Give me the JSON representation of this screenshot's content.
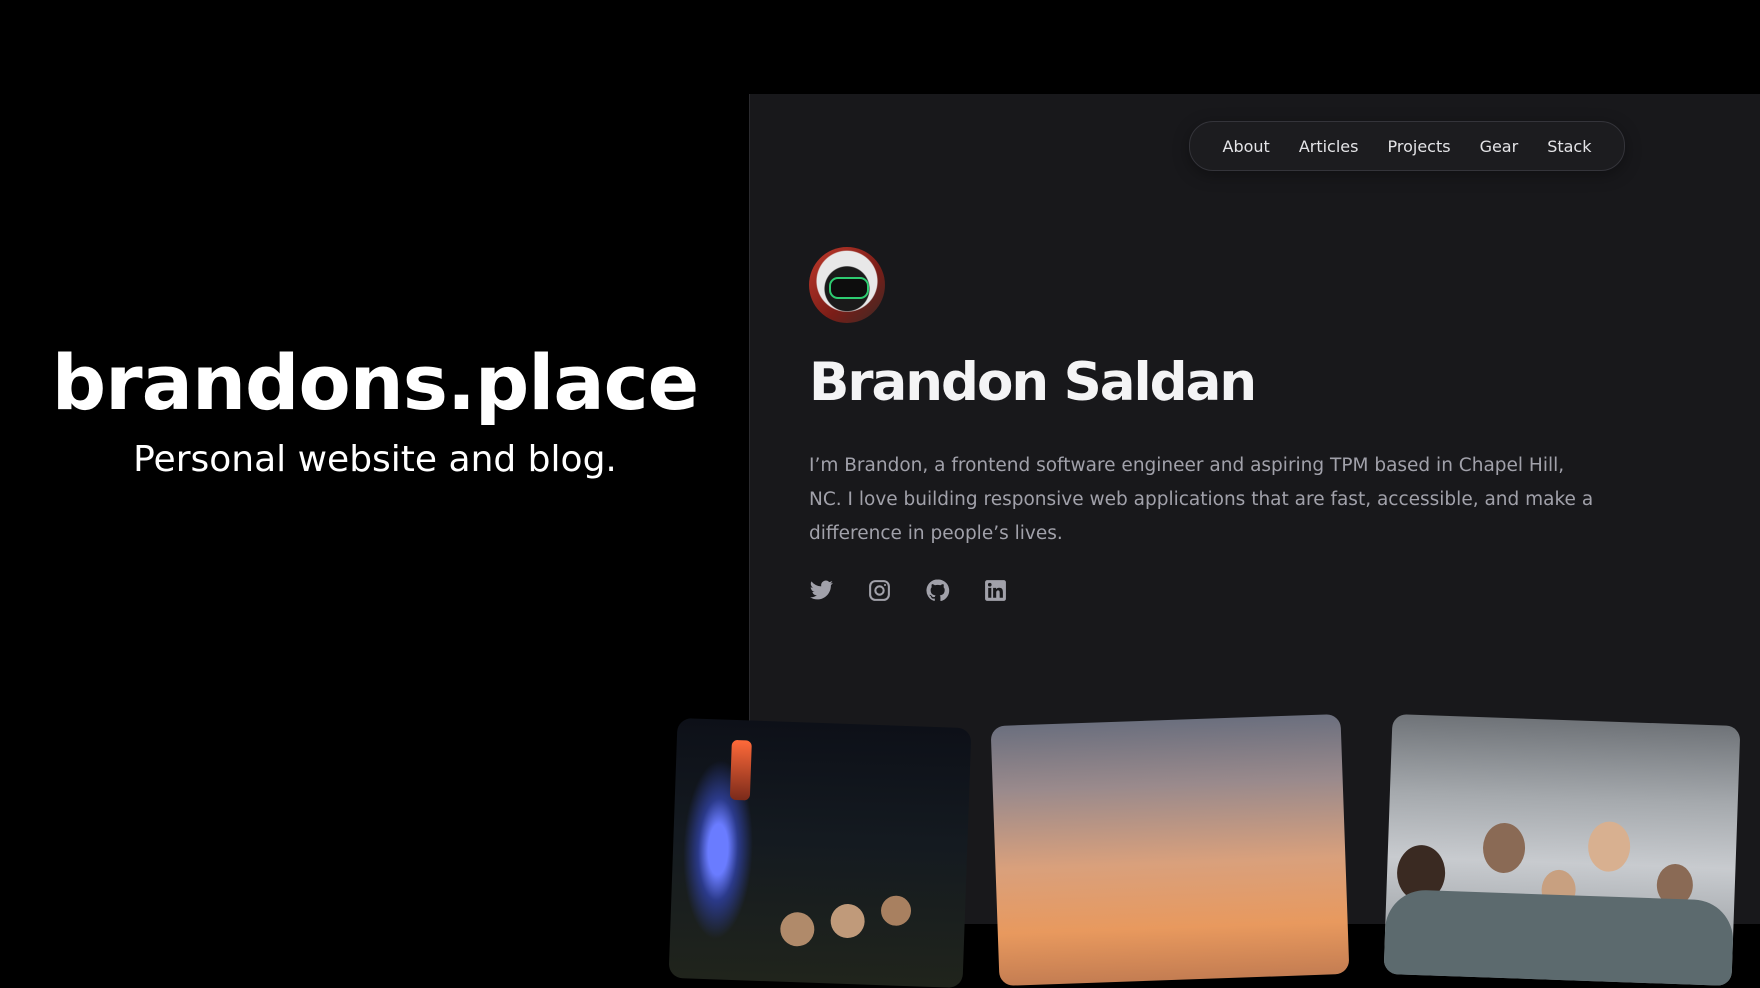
{
  "hero": {
    "title": "brandons.place",
    "tagline": "Personal website and blog."
  },
  "nav": {
    "items": [
      "About",
      "Articles",
      "Projects",
      "Gear",
      "Stack"
    ]
  },
  "profile": {
    "name": "Brandon Saldan",
    "bio": "I’m Brandon, a frontend software engineer and aspiring TPM based in Chapel Hill, NC. I love building responsive web applications that are fast, accessible, and make a difference in people’s lives."
  },
  "socials": [
    {
      "icon": "twitter-icon"
    },
    {
      "icon": "instagram-icon"
    },
    {
      "icon": "github-icon"
    },
    {
      "icon": "linkedin-icon"
    }
  ],
  "photos": [
    {
      "subject": "night-festival"
    },
    {
      "subject": "sunset-clouds"
    },
    {
      "subject": "group-of-friends"
    }
  ],
  "colors": {
    "page_background": "#000000",
    "panel_background": "#18181b",
    "text_primary": "#f4f4f5",
    "text_secondary": "#a1a1aa",
    "icon_color": "#a1a1aa"
  }
}
